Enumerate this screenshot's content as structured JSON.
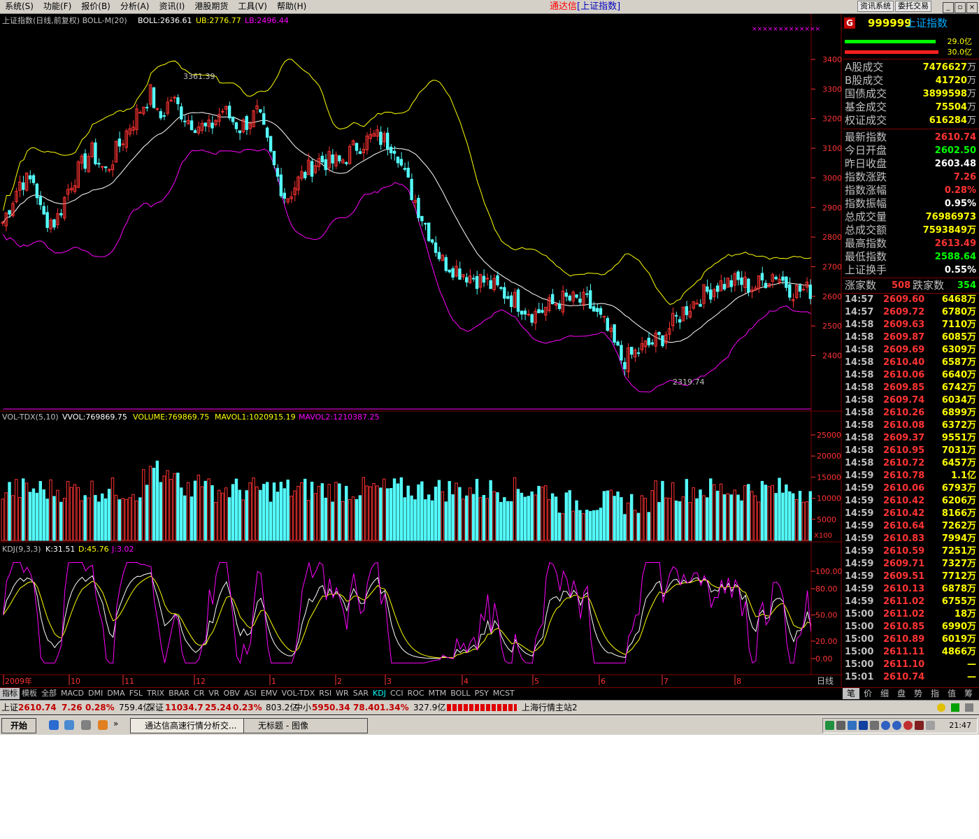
{
  "menu": [
    "系统(S)",
    "功能(F)",
    "报价(B)",
    "分析(A)",
    "资讯(I)",
    "港股期货",
    "工具(V)",
    "帮助(H)"
  ],
  "window_title": {
    "app": "通达信",
    "doc": "[上证指数]"
  },
  "top_buttons": [
    "资讯系统",
    "委托交易"
  ],
  "window_controls": [
    "_",
    "▫",
    "×"
  ],
  "main_panel": {
    "title": "上证指数(日线,前复权)  BOLL-M(20)",
    "boll": "BOLL:2636.61",
    "ub": "UB:2776.77",
    "lb": "LB:2496.44",
    "high_mark": "3361.39",
    "low_mark": "2319.74",
    "y_ticks": [
      "3400",
      "3300",
      "3200",
      "3100",
      "3000",
      "2900",
      "2800",
      "2700",
      "2600",
      "2500",
      "2400"
    ]
  },
  "vol_panel": {
    "title": "VOL-TDX(5,10)",
    "vvol": "VVOL:769869.75",
    "volume": "VOLUME:769869.75",
    "mavol1": "MAVOL1:1020915.19",
    "mavol2": "MAVOL2:1210387.25",
    "y_ticks": [
      "25000",
      "20000",
      "15000",
      "10000",
      "5000"
    ],
    "unit": "X100"
  },
  "kdj_panel": {
    "title": "KDJ(9,3,3)",
    "k": "K:31.51",
    "d": "D:45.76",
    "j": "J:3.02",
    "y_ticks": [
      "100.00",
      "80.00",
      "50.00",
      "20.00",
      "0.00"
    ]
  },
  "x_axis": {
    "labels": [
      "2009年",
      "10",
      "11",
      "12",
      "1",
      "2",
      "3",
      "4",
      "5",
      "6",
      "7",
      "8"
    ],
    "period": "日线"
  },
  "indicator_tabs": [
    "指标",
    "模板",
    "全部",
    "MACD",
    "DMI",
    "DMA",
    "FSL",
    "TRIX",
    "BRAR",
    "CR",
    "VR",
    "OBV",
    "ASI",
    "EMV",
    "VOL-TDX",
    "RSI",
    "WR",
    "SAR",
    "KDJ",
    "CCI",
    "ROC",
    "MTM",
    "BOLL",
    "PSY",
    "MCST"
  ],
  "active_tab": "KDJ",
  "right_panel": {
    "code": "999999",
    "name": "上证指数",
    "badge": "G",
    "bar_labels": [
      "29.0亿",
      "30.0亿"
    ],
    "turnover": [
      {
        "label": "A股成交",
        "value": "7476627",
        "unit": "万"
      },
      {
        "label": "B股成交",
        "value": "41720",
        "unit": "万"
      },
      {
        "label": "国债成交",
        "value": "3899598",
        "unit": "万"
      },
      {
        "label": "基金成交",
        "value": "75504",
        "unit": "万"
      },
      {
        "label": "权证成交",
        "value": "616284",
        "unit": "万"
      }
    ],
    "quotes": [
      {
        "label": "最新指数",
        "value": "2610.74",
        "color": "#ff3333"
      },
      {
        "label": "今日开盘",
        "value": "2602.50",
        "color": "#00ff00"
      },
      {
        "label": "昨日收盘",
        "value": "2603.48",
        "color": "#ffffff"
      },
      {
        "label": "指数涨跌",
        "value": "7.26",
        "color": "#ff3333"
      },
      {
        "label": "指数涨幅",
        "value": "0.28%",
        "color": "#ff3333"
      },
      {
        "label": "指数振幅",
        "value": "0.95%",
        "color": "#ffffff"
      },
      {
        "label": "总成交量",
        "value": "76986973",
        "color": "#ffff00"
      },
      {
        "label": "总成交额",
        "value": "7593849万",
        "color": "#ffff00"
      },
      {
        "label": "最高指数",
        "value": "2613.49",
        "color": "#ff3333"
      },
      {
        "label": "最低指数",
        "value": "2588.64",
        "color": "#00ff00"
      },
      {
        "label": "上证换手",
        "value": "0.55%",
        "color": "#ffffff"
      }
    ],
    "updown": {
      "up_label": "涨家数",
      "up": "508",
      "down_label": "跌家数",
      "down": "354"
    },
    "ticks": [
      [
        "14:57",
        "2609.60",
        "6468万"
      ],
      [
        "14:57",
        "2609.72",
        "6780万"
      ],
      [
        "14:58",
        "2609.63",
        "7110万"
      ],
      [
        "14:58",
        "2609.87",
        "6085万"
      ],
      [
        "14:58",
        "2609.69",
        "6309万"
      ],
      [
        "14:58",
        "2610.40",
        "6587万"
      ],
      [
        "14:58",
        "2610.06",
        "6640万"
      ],
      [
        "14:58",
        "2609.85",
        "6742万"
      ],
      [
        "14:58",
        "2609.74",
        "6034万"
      ],
      [
        "14:58",
        "2610.26",
        "6899万"
      ],
      [
        "14:58",
        "2610.08",
        "6372万"
      ],
      [
        "14:58",
        "2609.37",
        "9551万"
      ],
      [
        "14:58",
        "2610.95",
        "7031万"
      ],
      [
        "14:58",
        "2610.72",
        "6457万"
      ],
      [
        "14:59",
        "2610.78",
        "1.1亿"
      ],
      [
        "14:59",
        "2610.06",
        "6793万"
      ],
      [
        "14:59",
        "2610.42",
        "6206万"
      ],
      [
        "14:59",
        "2610.42",
        "8166万"
      ],
      [
        "14:59",
        "2610.64",
        "7262万"
      ],
      [
        "14:59",
        "2610.83",
        "7994万"
      ],
      [
        "14:59",
        "2610.59",
        "7251万"
      ],
      [
        "14:59",
        "2609.71",
        "7327万"
      ],
      [
        "14:59",
        "2609.51",
        "7712万"
      ],
      [
        "14:59",
        "2610.13",
        "6878万"
      ],
      [
        "14:59",
        "2611.02",
        "6755万"
      ],
      [
        "15:00",
        "2611.02",
        "18万"
      ],
      [
        "15:00",
        "2610.85",
        "6990万"
      ],
      [
        "15:00",
        "2610.89",
        "6019万"
      ],
      [
        "15:00",
        "2611.11",
        "4866万"
      ],
      [
        "15:00",
        "2611.10",
        "—"
      ],
      [
        "15:01",
        "2610.74",
        "—"
      ]
    ],
    "tabs": [
      "笔",
      "价",
      "细",
      "盘",
      "势",
      "指",
      "值",
      "筹"
    ],
    "active_tab": "笔"
  },
  "status_bar": {
    "sh_label": "上证",
    "sh_val": "2610.74",
    "sh_chg": "7.26",
    "sh_pct": "0.28%",
    "sh_amt": "759.4亿",
    "sz_label": "深证",
    "sz_val": "11034.7",
    "sz_chg": "25.24",
    "sz_pct": "0.23%",
    "sz_amt": "803.2亿",
    "zx_label": "中小",
    "zx_val": "5950.34",
    "zx_chg": "78.40",
    "zx_pct": "1.34%",
    "zx_amt": "327.9亿",
    "server": "上海行情主站2"
  },
  "taskbar": {
    "start": "开始",
    "tasks": [
      "通达信高速行情分析交...",
      "无标题 - 图像"
    ],
    "clock": "21:47"
  },
  "colors": {
    "up": "#ff3333",
    "down": "#54fcfc",
    "ub": "#ffff00",
    "mid": "#ffffff",
    "lb": "#ff00ff",
    "grid": "#800000",
    "axis": "#ff3333"
  }
}
